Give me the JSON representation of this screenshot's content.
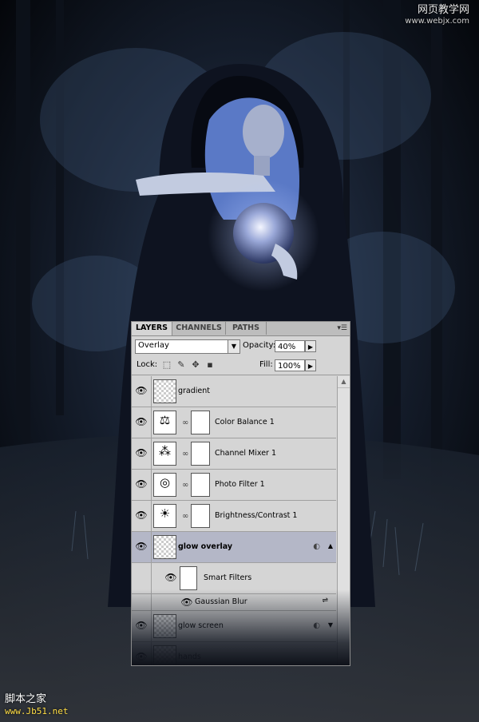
{
  "watermarks": {
    "top_line1": "网页教学网",
    "top_line2": "www.webjx.com",
    "bottom_line1": "脚本之家",
    "bottom_line2": "www.Jb51.net"
  },
  "panel": {
    "tabs": [
      {
        "label": "LAYERS",
        "active": true
      },
      {
        "label": "CHANNELS",
        "active": false
      },
      {
        "label": "PATHS",
        "active": false
      }
    ],
    "blend_mode": "Overlay",
    "opacity_label": "Opacity:",
    "opacity_value": "40%",
    "lock_label": "Lock:",
    "fill_label": "Fill:",
    "fill_value": "100%",
    "layers": [
      {
        "name": "gradient",
        "icon": "gradient-thumb"
      },
      {
        "name": "Color Balance 1",
        "icon": "scale-icon"
      },
      {
        "name": "Channel Mixer 1",
        "icon": "channel-mixer-icon"
      },
      {
        "name": "Photo Filter 1",
        "icon": "photo-filter-icon"
      },
      {
        "name": "Brightness/Contrast 1",
        "icon": "brightness-icon"
      },
      {
        "name": "glow overlay",
        "icon": "smart-object-thumb",
        "selected": true
      },
      {
        "name": "glow screen",
        "icon": "smart-object-thumb"
      },
      {
        "name": "hands",
        "icon": "smart-object-thumb"
      }
    ],
    "smart_filters_label": "Smart Filters",
    "gaussian_blur_label": "Gaussian Blur"
  }
}
